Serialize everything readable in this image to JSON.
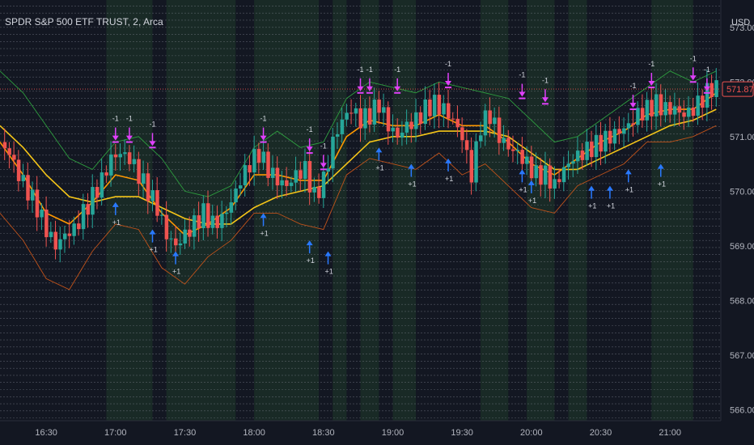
{
  "header": {
    "symbol_label": "SPDR S&P 500 ETF TRUST, 2, Arca",
    "currency": "USD"
  },
  "colors": {
    "background": "#131722",
    "bull": "#26a69a",
    "bear": "#ef5350",
    "ma_fast": "#ff9800",
    "ma_slow": "#f5c518",
    "band_upper": "#2e9e3f",
    "band_lower": "#c0521a",
    "sell_arrow": "#e040fb",
    "buy_arrow": "#2979ff",
    "price_badge": "#ef5350",
    "shade_green": "#1f3a2a"
  },
  "chart_data": {
    "type": "line",
    "title": "SPDR S&P 500 ETF TRUST, 2, Arca",
    "ylabel": "USD",
    "ylim": [
      565.8,
      573.5
    ],
    "y_ticks": [
      573.0,
      572.0,
      571.0,
      570.0,
      569.0,
      568.0,
      567.0,
      566.0
    ],
    "y_tick_labels": [
      "573.00",
      "572.00",
      "571.00",
      "570.00",
      "569.00",
      "568.00",
      "567.00",
      "566.00"
    ],
    "x_ticks": [
      "16:30",
      "17:00",
      "17:30",
      "18:00",
      "18:30",
      "19:00",
      "19:30",
      "20:00",
      "20:30",
      "21:00"
    ],
    "x_start": "16:10",
    "x_end": "21:22",
    "last_price": 571.87,
    "last_price_label": "571.87",
    "grid": "dotted horizontal levels",
    "series": [
      {
        "name": "",
        "type": "candles",
        "close_path": [
          [
            "16:10",
            570.9
          ],
          [
            "16:14",
            570.7
          ],
          [
            "16:18",
            570.3
          ],
          [
            "16:22",
            570.0
          ],
          [
            "16:26",
            569.7
          ],
          [
            "16:30",
            569.3
          ],
          [
            "16:34",
            569.0
          ],
          [
            "16:38",
            569.2
          ],
          [
            "16:42",
            569.3
          ],
          [
            "16:46",
            569.6
          ],
          [
            "16:50",
            569.9
          ],
          [
            "16:54",
            570.2
          ],
          [
            "16:58",
            570.6
          ],
          [
            "17:02",
            570.7
          ],
          [
            "17:06",
            570.6
          ],
          [
            "17:10",
            570.3
          ],
          [
            "17:14",
            570.0
          ],
          [
            "17:18",
            569.7
          ],
          [
            "17:22",
            569.2
          ],
          [
            "17:26",
            569.0
          ],
          [
            "17:30",
            569.2
          ],
          [
            "17:34",
            569.4
          ],
          [
            "17:38",
            569.6
          ],
          [
            "17:42",
            569.4
          ],
          [
            "17:46",
            569.5
          ],
          [
            "17:50",
            569.8
          ],
          [
            "17:54",
            570.2
          ],
          [
            "17:58",
            570.5
          ],
          [
            "18:02",
            570.7
          ],
          [
            "18:06",
            570.4
          ],
          [
            "18:10",
            570.2
          ],
          [
            "18:14",
            570.1
          ],
          [
            "18:18",
            570.3
          ],
          [
            "18:22",
            570.4
          ],
          [
            "18:26",
            569.9
          ],
          [
            "18:30",
            570.2
          ],
          [
            "18:34",
            570.9
          ],
          [
            "18:38",
            571.3
          ],
          [
            "18:42",
            571.5
          ],
          [
            "18:46",
            571.3
          ],
          [
            "18:50",
            571.4
          ],
          [
            "18:54",
            571.6
          ],
          [
            "18:58",
            571.2
          ],
          [
            "19:02",
            571.0
          ],
          [
            "19:06",
            571.2
          ],
          [
            "19:10",
            571.3
          ],
          [
            "19:14",
            571.5
          ],
          [
            "19:18",
            571.6
          ],
          [
            "19:22",
            571.5
          ],
          [
            "19:26",
            571.3
          ],
          [
            "19:30",
            571.0
          ],
          [
            "19:34",
            570.3
          ],
          [
            "19:38",
            571.2
          ],
          [
            "19:42",
            571.4
          ],
          [
            "19:46",
            571.0
          ],
          [
            "19:50",
            570.8
          ],
          [
            "19:54",
            570.7
          ],
          [
            "19:58",
            570.5
          ],
          [
            "20:02",
            570.3
          ],
          [
            "20:06",
            570.3
          ],
          [
            "20:10",
            570.1
          ],
          [
            "20:14",
            570.4
          ],
          [
            "20:18",
            570.6
          ],
          [
            "20:22",
            570.7
          ],
          [
            "20:26",
            570.8
          ],
          [
            "20:30",
            570.9
          ],
          [
            "20:34",
            571.0
          ],
          [
            "20:38",
            571.1
          ],
          [
            "20:42",
            571.2
          ],
          [
            "20:46",
            571.4
          ],
          [
            "20:50",
            571.5
          ],
          [
            "20:54",
            571.6
          ],
          [
            "20:58",
            571.5
          ],
          [
            "21:02",
            571.5
          ],
          [
            "21:06",
            571.4
          ],
          [
            "21:10",
            571.5
          ],
          [
            "21:14",
            571.7
          ],
          [
            "21:18",
            571.9
          ],
          [
            "21:20",
            571.87
          ]
        ]
      },
      {
        "name": "",
        "type": "line",
        "color_key": "ma_slow",
        "points": [
          [
            "16:10",
            571.2
          ],
          [
            "16:20",
            570.8
          ],
          [
            "16:30",
            570.3
          ],
          [
            "16:40",
            569.9
          ],
          [
            "16:50",
            569.8
          ],
          [
            "17:00",
            569.9
          ],
          [
            "17:10",
            569.9
          ],
          [
            "17:20",
            569.7
          ],
          [
            "17:30",
            569.5
          ],
          [
            "17:40",
            569.4
          ],
          [
            "17:50",
            569.4
          ],
          [
            "18:00",
            569.7
          ],
          [
            "18:10",
            569.9
          ],
          [
            "18:20",
            570.0
          ],
          [
            "18:30",
            570.1
          ],
          [
            "18:40",
            570.5
          ],
          [
            "18:50",
            570.9
          ],
          [
            "19:00",
            571.0
          ],
          [
            "19:10",
            571.0
          ],
          [
            "19:20",
            571.1
          ],
          [
            "19:30",
            571.1
          ],
          [
            "19:40",
            571.1
          ],
          [
            "19:50",
            571.0
          ],
          [
            "20:00",
            570.7
          ],
          [
            "20:10",
            570.4
          ],
          [
            "20:20",
            570.4
          ],
          [
            "20:30",
            570.6
          ],
          [
            "20:40",
            570.8
          ],
          [
            "20:50",
            571.0
          ],
          [
            "21:00",
            571.2
          ],
          [
            "21:10",
            571.3
          ],
          [
            "21:20",
            571.5
          ]
        ]
      },
      {
        "name": "",
        "type": "line",
        "color_key": "ma_fast",
        "points": [
          [
            "16:10",
            570.9
          ],
          [
            "16:20",
            570.3
          ],
          [
            "16:30",
            569.6
          ],
          [
            "16:40",
            569.4
          ],
          [
            "16:50",
            569.8
          ],
          [
            "17:00",
            570.3
          ],
          [
            "17:10",
            570.2
          ],
          [
            "17:20",
            569.6
          ],
          [
            "17:30",
            569.2
          ],
          [
            "17:40",
            569.4
          ],
          [
            "17:50",
            569.7
          ],
          [
            "18:00",
            570.3
          ],
          [
            "18:10",
            570.3
          ],
          [
            "18:20",
            570.2
          ],
          [
            "18:30",
            570.2
          ],
          [
            "18:40",
            571.0
          ],
          [
            "18:50",
            571.3
          ],
          [
            "19:00",
            571.2
          ],
          [
            "19:10",
            571.2
          ],
          [
            "19:20",
            571.4
          ],
          [
            "19:30",
            571.2
          ],
          [
            "19:40",
            571.2
          ],
          [
            "19:50",
            570.9
          ],
          [
            "20:00",
            570.5
          ],
          [
            "20:10",
            570.3
          ],
          [
            "20:20",
            570.6
          ],
          [
            "20:30",
            570.9
          ],
          [
            "20:40",
            571.1
          ],
          [
            "20:50",
            571.4
          ],
          [
            "21:00",
            571.5
          ],
          [
            "21:10",
            571.5
          ],
          [
            "21:20",
            571.8
          ]
        ]
      },
      {
        "name": "",
        "type": "line",
        "color_key": "band_upper",
        "points": [
          [
            "16:10",
            572.2
          ],
          [
            "16:20",
            571.8
          ],
          [
            "16:30",
            571.2
          ],
          [
            "16:40",
            570.6
          ],
          [
            "16:50",
            570.4
          ],
          [
            "17:00",
            570.9
          ],
          [
            "17:10",
            571.0
          ],
          [
            "17:20",
            570.6
          ],
          [
            "17:30",
            570.0
          ],
          [
            "17:40",
            569.9
          ],
          [
            "17:50",
            570.1
          ],
          [
            "18:00",
            570.8
          ],
          [
            "18:10",
            571.1
          ],
          [
            "18:20",
            570.8
          ],
          [
            "18:30",
            570.9
          ],
          [
            "18:40",
            571.7
          ],
          [
            "18:50",
            572.0
          ],
          [
            "19:00",
            571.9
          ],
          [
            "19:10",
            571.8
          ],
          [
            "19:20",
            572.0
          ],
          [
            "19:30",
            571.9
          ],
          [
            "19:40",
            571.8
          ],
          [
            "19:50",
            571.7
          ],
          [
            "20:00",
            571.3
          ],
          [
            "20:10",
            570.9
          ],
          [
            "20:20",
            571.0
          ],
          [
            "20:30",
            571.3
          ],
          [
            "20:40",
            571.6
          ],
          [
            "20:50",
            571.9
          ],
          [
            "21:00",
            572.2
          ],
          [
            "21:10",
            572.0
          ],
          [
            "21:20",
            572.2
          ]
        ]
      },
      {
        "name": "",
        "type": "line",
        "color_key": "band_lower",
        "points": [
          [
            "16:10",
            569.6
          ],
          [
            "16:20",
            569.1
          ],
          [
            "16:30",
            568.4
          ],
          [
            "16:40",
            568.2
          ],
          [
            "16:50",
            568.9
          ],
          [
            "17:00",
            569.4
          ],
          [
            "17:10",
            569.3
          ],
          [
            "17:20",
            568.6
          ],
          [
            "17:30",
            568.3
          ],
          [
            "17:40",
            568.8
          ],
          [
            "17:50",
            569.1
          ],
          [
            "18:00",
            569.6
          ],
          [
            "18:10",
            569.6
          ],
          [
            "18:20",
            569.4
          ],
          [
            "18:30",
            569.3
          ],
          [
            "18:40",
            570.3
          ],
          [
            "18:50",
            570.6
          ],
          [
            "19:00",
            570.5
          ],
          [
            "19:10",
            570.4
          ],
          [
            "19:20",
            570.7
          ],
          [
            "19:30",
            570.3
          ],
          [
            "19:40",
            570.5
          ],
          [
            "19:50",
            570.1
          ],
          [
            "20:00",
            569.7
          ],
          [
            "20:10",
            569.6
          ],
          [
            "20:20",
            570.1
          ],
          [
            "20:30",
            570.3
          ],
          [
            "20:40",
            570.5
          ],
          [
            "20:50",
            570.9
          ],
          [
            "21:00",
            570.9
          ],
          [
            "21:10",
            571.0
          ],
          [
            "21:20",
            571.2
          ]
        ]
      }
    ],
    "sell_signals": [
      [
        "17:00",
        570.9
      ],
      [
        "17:06",
        570.9
      ],
      [
        "17:16",
        570.8
      ],
      [
        "18:04",
        570.9
      ],
      [
        "18:24",
        570.7
      ],
      [
        "18:30",
        570.4
      ],
      [
        "18:46",
        571.8
      ],
      [
        "18:50",
        571.8
      ],
      [
        "19:02",
        571.8
      ],
      [
        "19:24",
        571.9
      ],
      [
        "19:56",
        571.7
      ],
      [
        "20:06",
        571.6
      ],
      [
        "20:44",
        571.5
      ],
      [
        "20:52",
        571.9
      ],
      [
        "21:10",
        572.0
      ],
      [
        "21:16",
        571.8
      ]
    ],
    "buy_signals": [
      [
        "17:00",
        569.8
      ],
      [
        "17:16",
        569.3
      ],
      [
        "17:26",
        568.9
      ],
      [
        "18:04",
        569.6
      ],
      [
        "18:24",
        569.1
      ],
      [
        "18:32",
        568.9
      ],
      [
        "18:54",
        570.8
      ],
      [
        "19:08",
        570.5
      ],
      [
        "19:24",
        570.6
      ],
      [
        "19:56",
        570.4
      ],
      [
        "20:00",
        570.2
      ],
      [
        "20:26",
        570.1
      ],
      [
        "20:34",
        570.1
      ],
      [
        "20:42",
        570.4
      ],
      [
        "20:56",
        570.5
      ]
    ],
    "annotations": [
      "+1",
      "-1"
    ],
    "shaded_bands": [
      [
        "16:56",
        "17:16"
      ],
      [
        "17:22",
        "17:52"
      ],
      [
        "18:00",
        "18:28"
      ],
      [
        "18:34",
        "18:40"
      ],
      [
        "18:46",
        "18:54"
      ],
      [
        "19:00",
        "19:10"
      ],
      [
        "19:38",
        "19:50"
      ],
      [
        "19:58",
        "20:10"
      ],
      [
        "20:16",
        "20:24"
      ],
      [
        "20:52",
        "21:10"
      ]
    ]
  }
}
